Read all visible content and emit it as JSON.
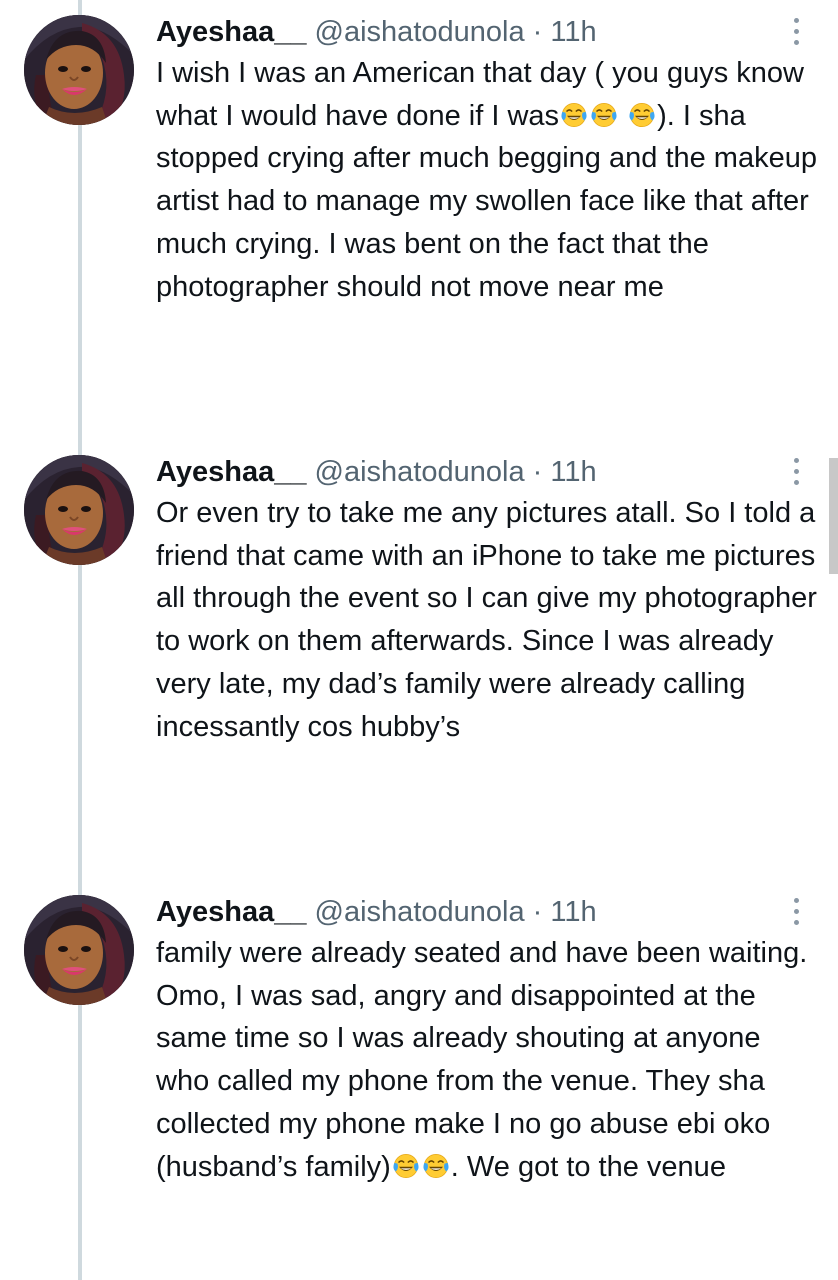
{
  "tweets": [
    {
      "display_name": "Ayeshaa__",
      "handle": "@aishatodunola",
      "separator": "·",
      "time": "11h",
      "text_1": "I wish I was an American that day ( you guys know what I would have done if I was",
      "text_2": "). I sha stopped crying after much begging and the makeup artist had to manage my swollen face like that after much crying. I was bent on the fact that the photographer should not move near me",
      "emojis": [
        "face-with-tears-of-joy-icon",
        "face-with-tears-of-joy-icon",
        "face-with-tears-of-joy-icon"
      ]
    },
    {
      "display_name": "Ayeshaa__",
      "handle": "@aishatodunola",
      "separator": "·",
      "time": "11h",
      "text_1": "Or even try to take me any pictures atall. So I told a friend that came with an iPhone to take me pictures all through the event so I can give my photographer to work on them afterwards. Since I was already very late, my dad’s family were already calling incessantly cos hubby’s"
    },
    {
      "display_name": "Ayeshaa__",
      "handle": "@aishatodunola",
      "separator": "·",
      "time": "11h",
      "text_1": "family were already seated and have been waiting. Omo, I was sad, angry and disappointed at the same time so I was already shouting at anyone who called my phone from the venue. They sha collected my phone make I no go abuse ebi oko (husband’s family)",
      "text_2": ". We got to the venue",
      "emojis": [
        "face-with-tears-of-joy-icon",
        "face-with-tears-of-joy-icon"
      ]
    }
  ],
  "colors": {
    "text": "#0f1419",
    "secondary": "#536471",
    "thread_line": "#cfd9de",
    "emoji_face": "#ffcc33",
    "emoji_tears": "#3ea7f2"
  }
}
